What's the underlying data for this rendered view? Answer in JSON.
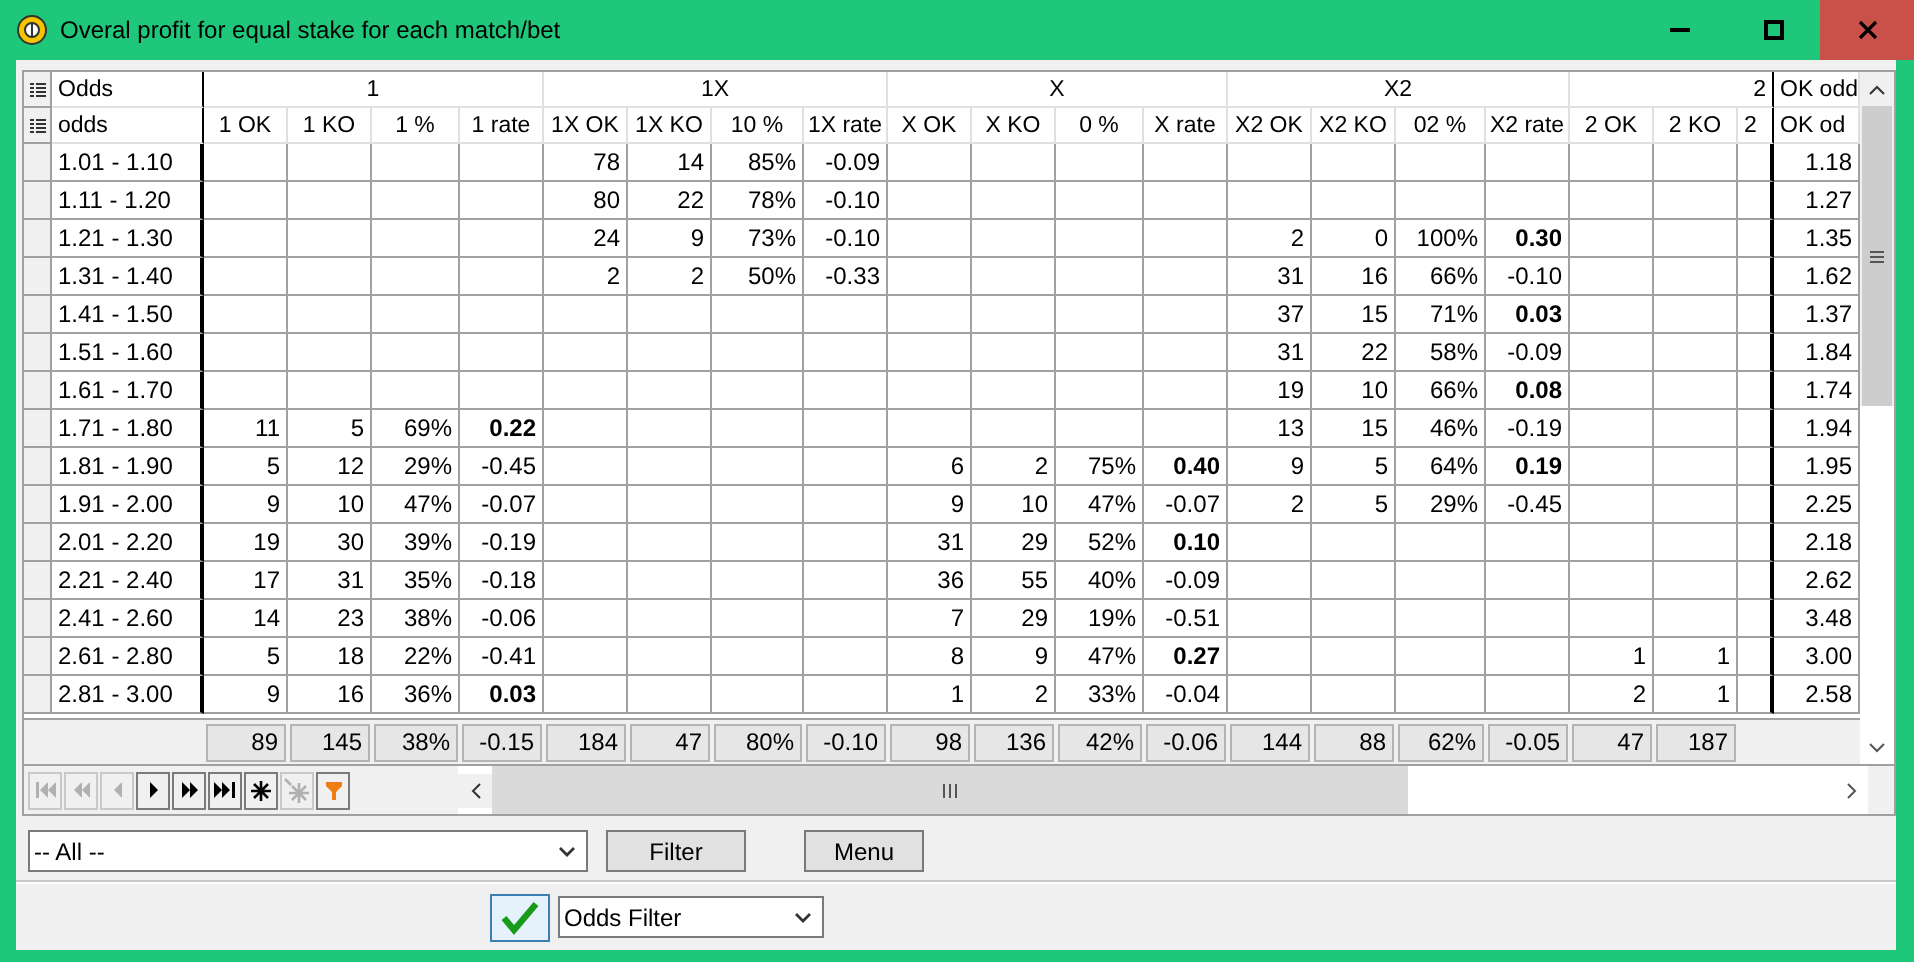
{
  "window": {
    "title": "Overal profit for equal stake for each match/bet"
  },
  "grid": {
    "group_header": {
      "label": "Odds"
    },
    "groups": [
      "1",
      "1X",
      "X",
      "X2",
      "2",
      "OK odd"
    ],
    "row_header": {
      "label": "odds"
    },
    "columns": [
      "1 OK",
      "1 KO",
      "1 %",
      "1 rate",
      "1X OK",
      "1X KO",
      "10 %",
      "1X rate",
      "X OK",
      "X KO",
      "0 %",
      "X rate",
      "X2 OK",
      "X2 KO",
      "02 %",
      "X2 rate",
      "2 OK",
      "2 KO",
      "2",
      "OK od"
    ],
    "rows": [
      {
        "odds": "1.01 - 1.10",
        "g1x": {
          "ok": "78",
          "ko": "14",
          "pct": "85%",
          "rate": "-0.09",
          "bold": false
        },
        "ok_odd": "1.18"
      },
      {
        "odds": "1.11 - 1.20",
        "g1x": {
          "ok": "80",
          "ko": "22",
          "pct": "78%",
          "rate": "-0.10",
          "bold": false
        },
        "ok_odd": "1.27"
      },
      {
        "odds": "1.21 - 1.30",
        "g1x": {
          "ok": "24",
          "ko": "9",
          "pct": "73%",
          "rate": "-0.10",
          "bold": false
        },
        "gx2": {
          "ok": "2",
          "ko": "0",
          "pct": "100%",
          "rate": "0.30",
          "bold": true
        },
        "ok_odd": "1.35"
      },
      {
        "odds": "1.31 - 1.40",
        "g1x": {
          "ok": "2",
          "ko": "2",
          "pct": "50%",
          "rate": "-0.33",
          "bold": false
        },
        "gx2": {
          "ok": "31",
          "ko": "16",
          "pct": "66%",
          "rate": "-0.10",
          "bold": false
        },
        "ok_odd": "1.62"
      },
      {
        "odds": "1.41 - 1.50",
        "gx2": {
          "ok": "37",
          "ko": "15",
          "pct": "71%",
          "rate": "0.03",
          "bold": true
        },
        "ok_odd": "1.37"
      },
      {
        "odds": "1.51 - 1.60",
        "gx2": {
          "ok": "31",
          "ko": "22",
          "pct": "58%",
          "rate": "-0.09",
          "bold": false
        },
        "ok_odd": "1.84"
      },
      {
        "odds": "1.61 - 1.70",
        "gx2": {
          "ok": "19",
          "ko": "10",
          "pct": "66%",
          "rate": "0.08",
          "bold": true
        },
        "ok_odd": "1.74"
      },
      {
        "odds": "1.71 - 1.80",
        "g1": {
          "ok": "11",
          "ko": "5",
          "pct": "69%",
          "rate": "0.22",
          "bold": true
        },
        "gx2": {
          "ok": "13",
          "ko": "15",
          "pct": "46%",
          "rate": "-0.19",
          "bold": false
        },
        "ok_odd": "1.94"
      },
      {
        "odds": "1.81 - 1.90",
        "g1": {
          "ok": "5",
          "ko": "12",
          "pct": "29%",
          "rate": "-0.45",
          "bold": false
        },
        "gx": {
          "ok": "6",
          "ko": "2",
          "pct": "75%",
          "rate": "0.40",
          "bold": true
        },
        "gx2": {
          "ok": "9",
          "ko": "5",
          "pct": "64%",
          "rate": "0.19",
          "bold": true
        },
        "ok_odd": "1.95"
      },
      {
        "odds": "1.91 - 2.00",
        "g1": {
          "ok": "9",
          "ko": "10",
          "pct": "47%",
          "rate": "-0.07",
          "bold": false
        },
        "gx": {
          "ok": "9",
          "ko": "10",
          "pct": "47%",
          "rate": "-0.07",
          "bold": false
        },
        "gx2": {
          "ok": "2",
          "ko": "5",
          "pct": "29%",
          "rate": "-0.45",
          "bold": false
        },
        "ok_odd": "2.25"
      },
      {
        "odds": "2.01 - 2.20",
        "g1": {
          "ok": "19",
          "ko": "30",
          "pct": "39%",
          "rate": "-0.19",
          "bold": false
        },
        "gx": {
          "ok": "31",
          "ko": "29",
          "pct": "52%",
          "rate": "0.10",
          "bold": true
        },
        "ok_odd": "2.18"
      },
      {
        "odds": "2.21 - 2.40",
        "g1": {
          "ok": "17",
          "ko": "31",
          "pct": "35%",
          "rate": "-0.18",
          "bold": false
        },
        "gx": {
          "ok": "36",
          "ko": "55",
          "pct": "40%",
          "rate": "-0.09",
          "bold": false
        },
        "ok_odd": "2.62"
      },
      {
        "odds": "2.41 - 2.60",
        "g1": {
          "ok": "14",
          "ko": "23",
          "pct": "38%",
          "rate": "-0.06",
          "bold": false
        },
        "gx": {
          "ok": "7",
          "ko": "29",
          "pct": "19%",
          "rate": "-0.51",
          "bold": false
        },
        "ok_odd": "3.48"
      },
      {
        "odds": "2.61 - 2.80",
        "g1": {
          "ok": "5",
          "ko": "18",
          "pct": "22%",
          "rate": "-0.41",
          "bold": false
        },
        "gx": {
          "ok": "8",
          "ko": "9",
          "pct": "47%",
          "rate": "0.27",
          "bold": true
        },
        "g2": {
          "ok": "1",
          "ko": "1"
        },
        "ok_odd": "3.00"
      },
      {
        "odds": "2.81 - 3.00",
        "g1": {
          "ok": "9",
          "ko": "16",
          "pct": "36%",
          "rate": "0.03",
          "bold": true
        },
        "gx": {
          "ok": "1",
          "ko": "2",
          "pct": "33%",
          "rate": "-0.04",
          "bold": false
        },
        "g2": {
          "ok": "2",
          "ko": "1"
        },
        "ok_odd": "2.58"
      }
    ],
    "totals": {
      "g1": {
        "ok": "89",
        "ko": "145",
        "pct": "38%",
        "rate": "-0.15"
      },
      "g1x": {
        "ok": "184",
        "ko": "47",
        "pct": "80%",
        "rate": "-0.10"
      },
      "gx": {
        "ok": "98",
        "ko": "136",
        "pct": "42%",
        "rate": "-0.06"
      },
      "gx2": {
        "ok": "144",
        "ko": "88",
        "pct": "62%",
        "rate": "-0.05"
      },
      "g2": {
        "ok": "47",
        "ko": "187"
      }
    }
  },
  "navigator": [
    {
      "kind": "first",
      "disabled": true
    },
    {
      "kind": "prior_page",
      "disabled": true
    },
    {
      "kind": "prior",
      "disabled": true
    },
    {
      "kind": "next",
      "disabled": false
    },
    {
      "kind": "next_page",
      "disabled": false
    },
    {
      "kind": "last",
      "disabled": false
    },
    {
      "kind": "insert",
      "disabled": false
    },
    {
      "kind": "delete",
      "disabled": true
    },
    {
      "kind": "filter",
      "disabled": false
    }
  ],
  "filter_bar": {
    "select": {
      "value": "-- All --"
    },
    "filter_button": "Filter",
    "menu_button": "Menu"
  },
  "bottom_bar": {
    "toggle": {
      "checked": true
    },
    "select": {
      "value": "Odds Filter"
    }
  }
}
